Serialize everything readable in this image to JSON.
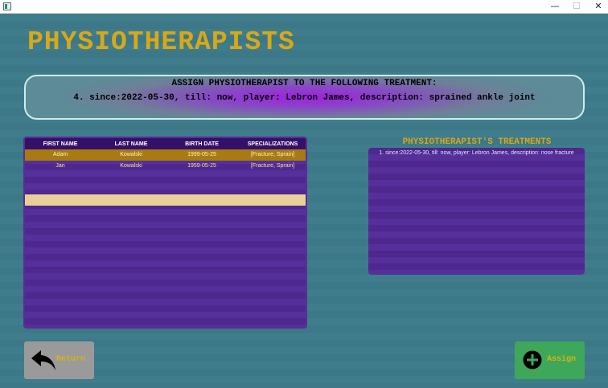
{
  "window": {
    "minimize_glyph": "—",
    "maximize_glyph": "☐",
    "close_glyph": "✕"
  },
  "page": {
    "title": "PHYSIOTHERAPISTS"
  },
  "banner": {
    "heading": "ASSIGN PHYSIOTHERAPIST TO THE FOLLOWING TREATMENT:",
    "treatment": "4. since:2022-05-30, till: now, player: Lebron James, description: sprained ankle joint"
  },
  "table": {
    "columns": [
      "FIRST NAME",
      "LAST NAME",
      "BIRTH DATE",
      "SPECIALIZATIONS"
    ],
    "rows": [
      [
        "Adam",
        "Kowalski",
        "1999-05-25",
        "[Fracture, Sprain]"
      ],
      [
        "Jan",
        "Kowalski",
        "1959-05-25",
        "[Fracture, Sprain]"
      ]
    ],
    "selected_row": 0
  },
  "treatments": {
    "title": "PHYSIOTHERAPIST'S TREATMENTS",
    "items": [
      "1. since:2022-05-30, till: now, player: Lebron James, description: nose fracture"
    ]
  },
  "buttons": {
    "return_label": "Return",
    "assign_label": "Assign",
    "return_icon": "back-arrow-icon",
    "assign_icon": "plus-circle-icon"
  },
  "colors": {
    "background": "#3f7d8c",
    "title": "#d9a817",
    "table_header": "#35106b",
    "table_body": "#4e278f",
    "selected_row": "#a87b12",
    "return_button": "#9a9a9a",
    "assign_button": "#3fa75a"
  }
}
